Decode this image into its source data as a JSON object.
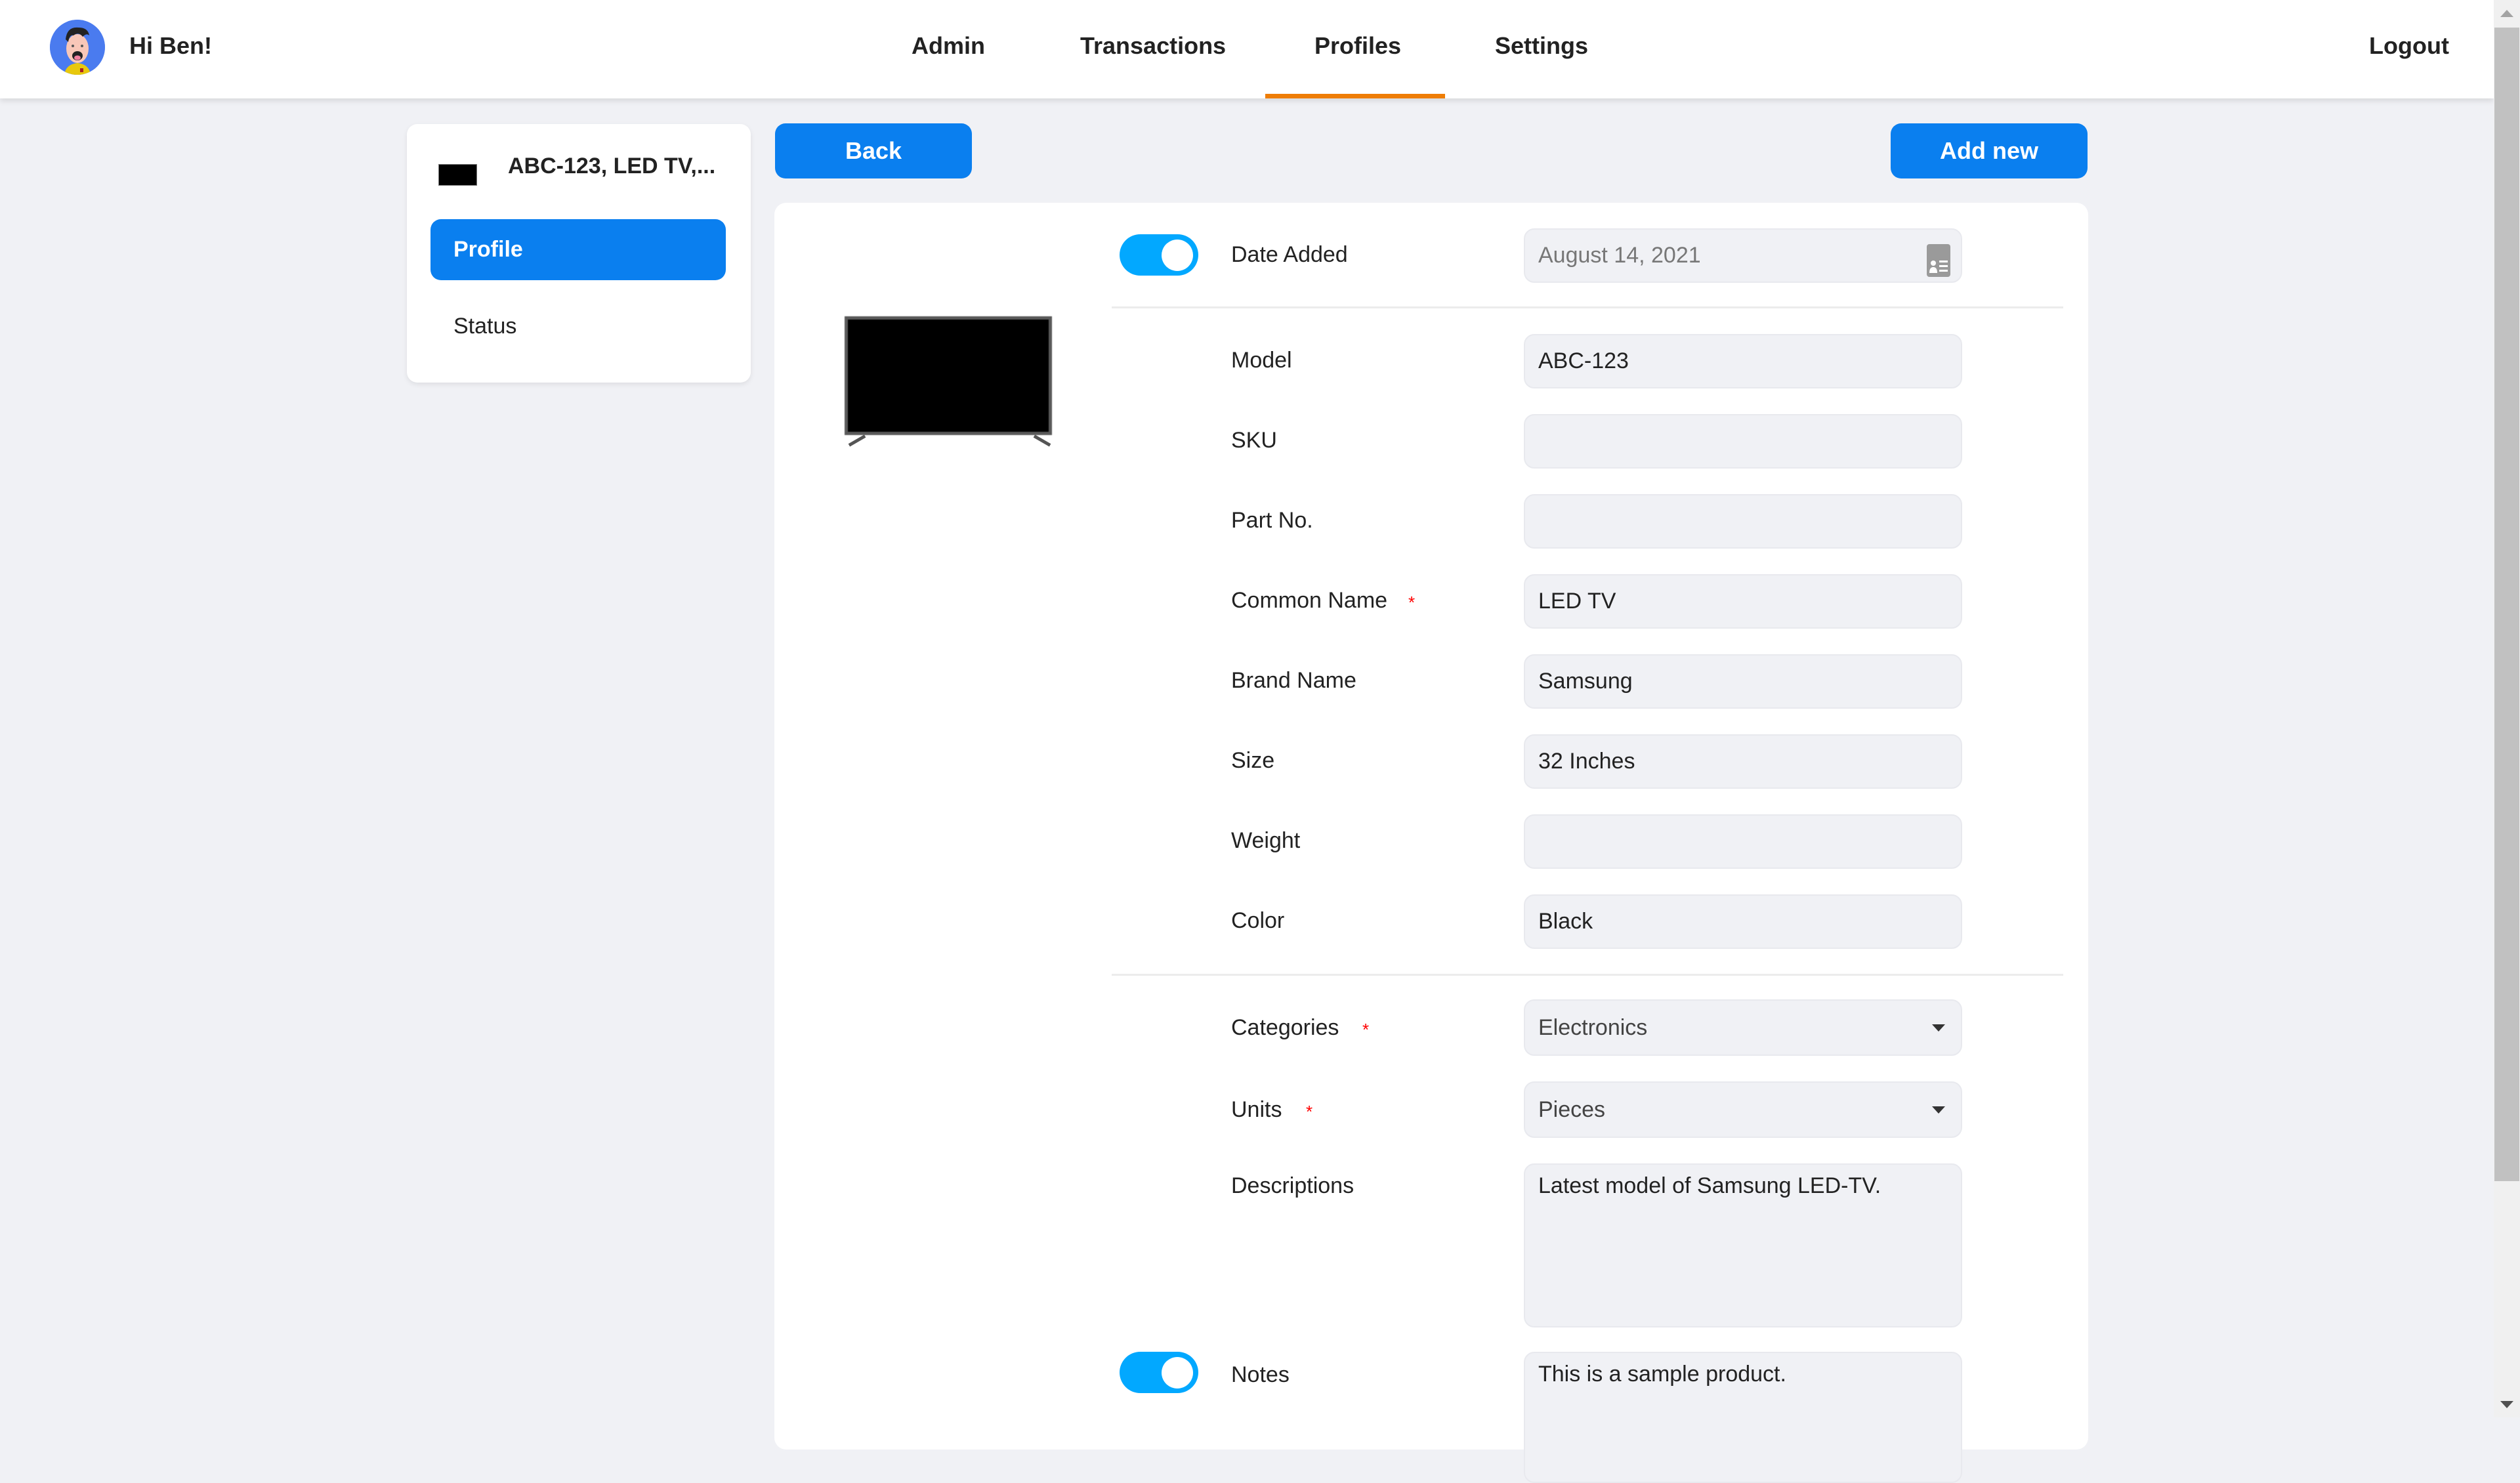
{
  "header": {
    "greeting": "Hi Ben!",
    "nav": [
      {
        "label": "Admin",
        "active": false
      },
      {
        "label": "Transactions",
        "active": false
      },
      {
        "label": "Profiles",
        "active": true
      },
      {
        "label": "Settings",
        "active": false
      }
    ],
    "logout_label": "Logout",
    "accent_color": "#ee7d05"
  },
  "sidebar": {
    "title": "ABC-123, LED TV,...",
    "items": [
      {
        "label": "Profile",
        "active": true
      },
      {
        "label": "Status",
        "active": false
      }
    ]
  },
  "toolbar": {
    "back_label": "Back",
    "add_new_label": "Add new",
    "button_color": "#0a7fef"
  },
  "form": {
    "date_added": {
      "label": "Date Added",
      "value": "August 14, 2021",
      "toggle_on": true,
      "icon": "address-card-icon"
    },
    "fields": [
      {
        "label": "Model",
        "value": "ABC-123",
        "required": false
      },
      {
        "label": "SKU",
        "value": "",
        "required": false
      },
      {
        "label": "Part No.",
        "value": "",
        "required": false
      },
      {
        "label": "Common Name",
        "value": "LED TV",
        "required": true
      },
      {
        "label": "Brand Name",
        "value": "Samsung",
        "required": false
      },
      {
        "label": "Size",
        "value": "32 Inches",
        "required": false
      },
      {
        "label": "Weight",
        "value": "",
        "required": false
      },
      {
        "label": "Color",
        "value": "Black",
        "required": false
      }
    ],
    "categories": {
      "label": "Categories",
      "value": "Electronics",
      "required": true
    },
    "units": {
      "label": "Units",
      "value": "Pieces",
      "required": true
    },
    "descriptions": {
      "label": "Descriptions",
      "value": "Latest model of Samsung LED-TV."
    },
    "notes": {
      "label": "Notes",
      "value": "This is a sample product.",
      "toggle_on": true
    },
    "required_marker": "*",
    "toggle_color": "#02a8ff"
  }
}
